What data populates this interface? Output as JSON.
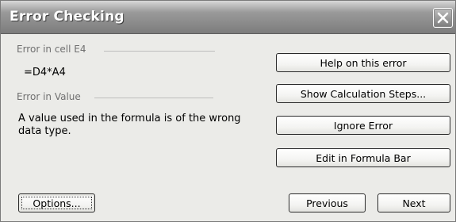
{
  "window": {
    "title": "Error Checking"
  },
  "error": {
    "cell_label": "Error in cell E4",
    "formula": "=D4*A4",
    "type_label": "Error in Value",
    "description": "A value used in the formula is of the wrong data type."
  },
  "actions": {
    "help": "Help on this error",
    "show_steps": "Show Calculation Steps...",
    "ignore": "Ignore Error",
    "edit_formula_bar": "Edit in Formula Bar"
  },
  "footer": {
    "options": "Options...",
    "previous": "Previous",
    "next": "Next"
  }
}
